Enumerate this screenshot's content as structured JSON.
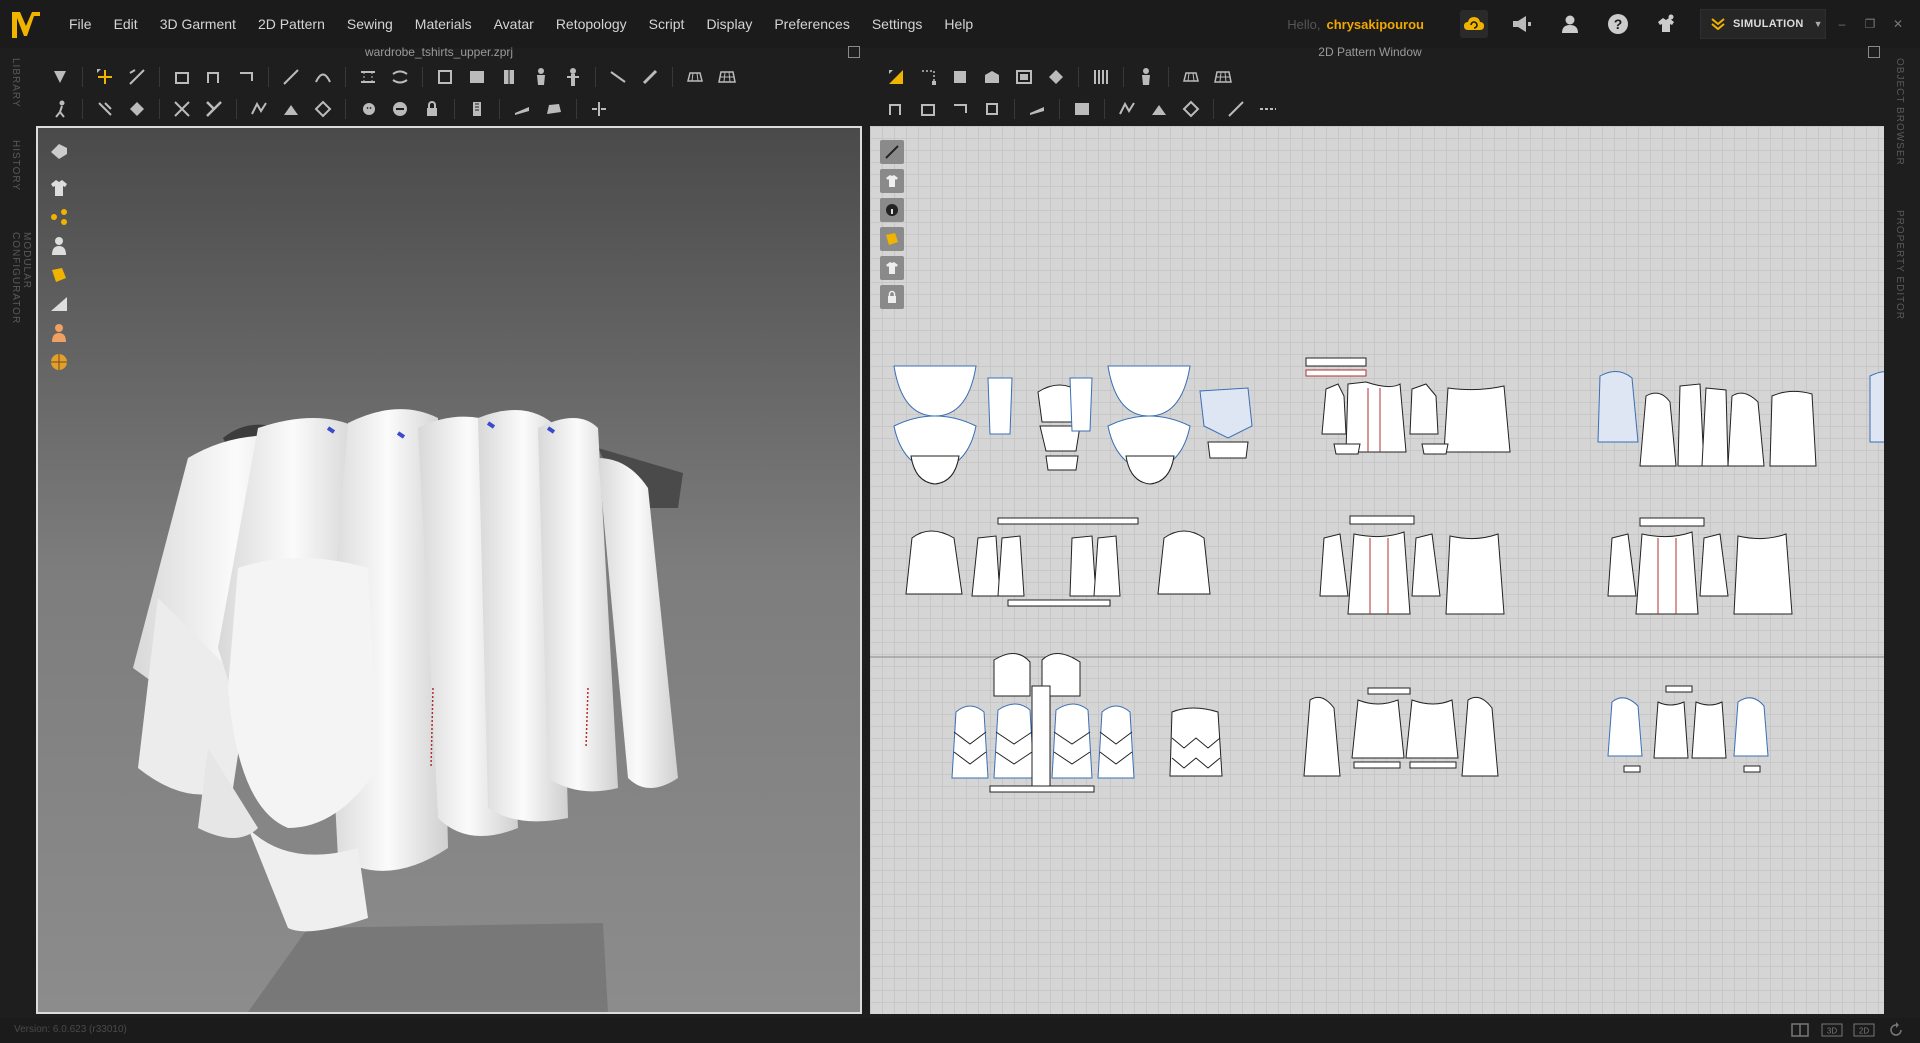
{
  "app": {
    "logo_letter": "M",
    "accent": "#f0b400"
  },
  "menu": [
    "File",
    "Edit",
    "3D Garment",
    "2D Pattern",
    "Sewing",
    "Materials",
    "Avatar",
    "Retopology",
    "Script",
    "Display",
    "Preferences",
    "Settings",
    "Help"
  ],
  "user": {
    "greeting": "Hello,",
    "name": "chrysakipourou"
  },
  "mode": {
    "label": "SIMULATION"
  },
  "left_tabs": [
    "LIBRARY",
    "HISTORY",
    "MODULAR CONFIGURATOR"
  ],
  "right_tabs": [
    "OBJECT BROWSER",
    "PROPERTY EDITOR"
  ],
  "viewport3d": {
    "title": "wardrobe_tshirts_upper.zprj"
  },
  "pattern_window": {
    "title": "2D Pattern Window"
  },
  "status": {
    "version": "Version: 6.0.623 (r33010)",
    "view_buttons": [
      "split-view",
      "3D",
      "2D"
    ]
  },
  "colors": {
    "bg": "#1e1e1e",
    "accent": "#f0b400",
    "pattern_outline_blue": "#3a6fb5",
    "pattern_red": "#b03030"
  }
}
